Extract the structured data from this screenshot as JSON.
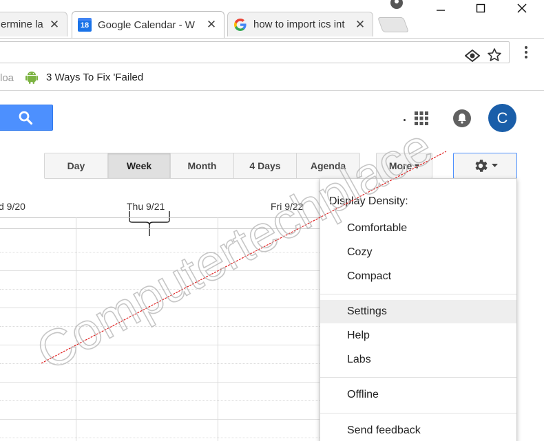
{
  "browser": {
    "tabs": [
      {
        "title": "ermine la",
        "active": false
      },
      {
        "title": "Google Calendar - W",
        "active": true,
        "favicon_text": "18"
      },
      {
        "title": "how to import ics int",
        "active": false
      }
    ],
    "bookmarks": [
      {
        "label": "loa"
      },
      {
        "label": "3 Ways To Fix 'Failed"
      }
    ]
  },
  "header": {
    "avatar_initial": "C"
  },
  "views": [
    "Day",
    "Week",
    "Month",
    "4 Days",
    "Agenda",
    "More ▾"
  ],
  "active_view": "Week",
  "days": [
    {
      "label": "d 9/20"
    },
    {
      "label": "Thu 9/21"
    },
    {
      "label": "Fri 9/22"
    }
  ],
  "settings_menu": {
    "display_density_label": "Display Density:",
    "density_options": [
      "Comfortable",
      "Cozy",
      "Compact"
    ],
    "items": [
      "Settings",
      "Help",
      "Labs"
    ],
    "offline": "Offline",
    "feedback": "Send feedback"
  },
  "watermark": "Computertechplace",
  "colors": {
    "accent_blue": "#4d90fe",
    "avatar_blue": "#1a5ea9",
    "watermark_red_line": "#e02020"
  }
}
